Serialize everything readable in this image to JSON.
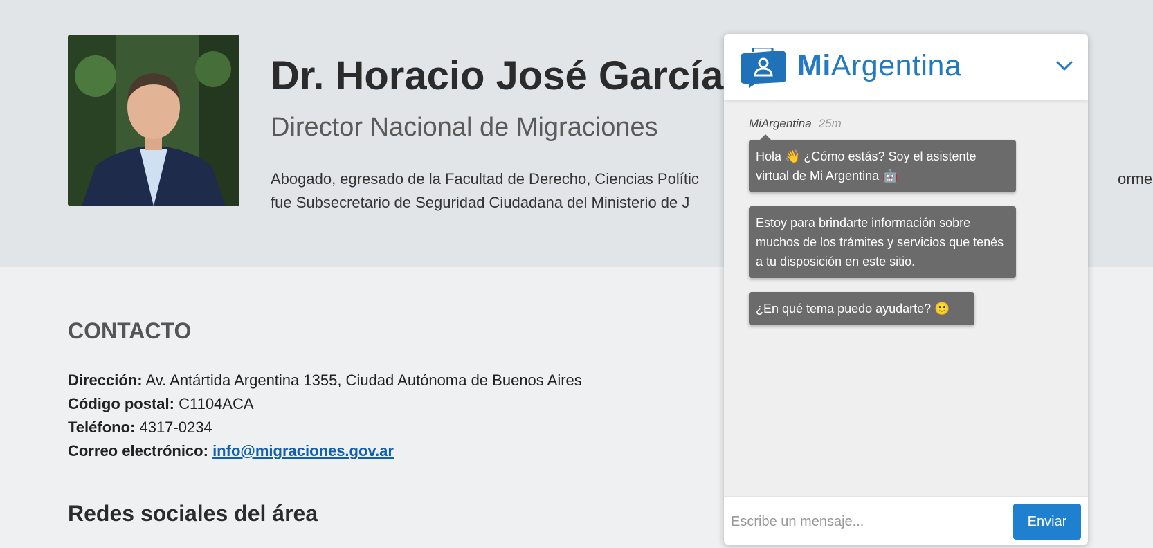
{
  "profile": {
    "name": "Dr. Horacio José García",
    "role": "Director Nacional de Migraciones",
    "bio_line1": "Abogado, egresado de la Facultad de Derecho, Ciencias Polític",
    "bio_line1_tail": "ormente",
    "bio_line2": "fue Subsecretario de Seguridad Ciudadana del Ministerio de J"
  },
  "contact": {
    "title": "CONTACTO",
    "address_label": "Dirección:",
    "address": " Av. Antártida Argentina 1355, Ciudad Autónoma de Buenos Aires",
    "postal_label": "Código postal:",
    "postal": " C1104ACA",
    "phone_label": "Teléfono:",
    "phone": " 4317-0234",
    "email_label": "Correo electrónico:",
    "email": "info@migraciones.gov.ar "
  },
  "social": {
    "title": "Redes sociales del área"
  },
  "chat": {
    "brand_bold": "Mi",
    "brand_rest": "Argentina",
    "sender": "MiArgentina",
    "time": "25m",
    "messages": [
      "Hola 👋 ¿Cómo estás? Soy el asistente virtual de Mi Argentina 🤖",
      "Estoy para brindarte información sobre muchos de los trámites y servicios que tenés a tu disposición en este sitio.",
      "¿En qué tema puedo ayudarte? 🙂"
    ],
    "input_placeholder": "Escribe un mensaje...",
    "send_label": "Enviar",
    "colors": {
      "accent": "#1f80cf",
      "bubble": "#6b6b6b",
      "brand": "#2379c2"
    },
    "icons": {
      "logo": "miargentina-logo-icon",
      "collapse": "chevron-down-icon"
    }
  }
}
